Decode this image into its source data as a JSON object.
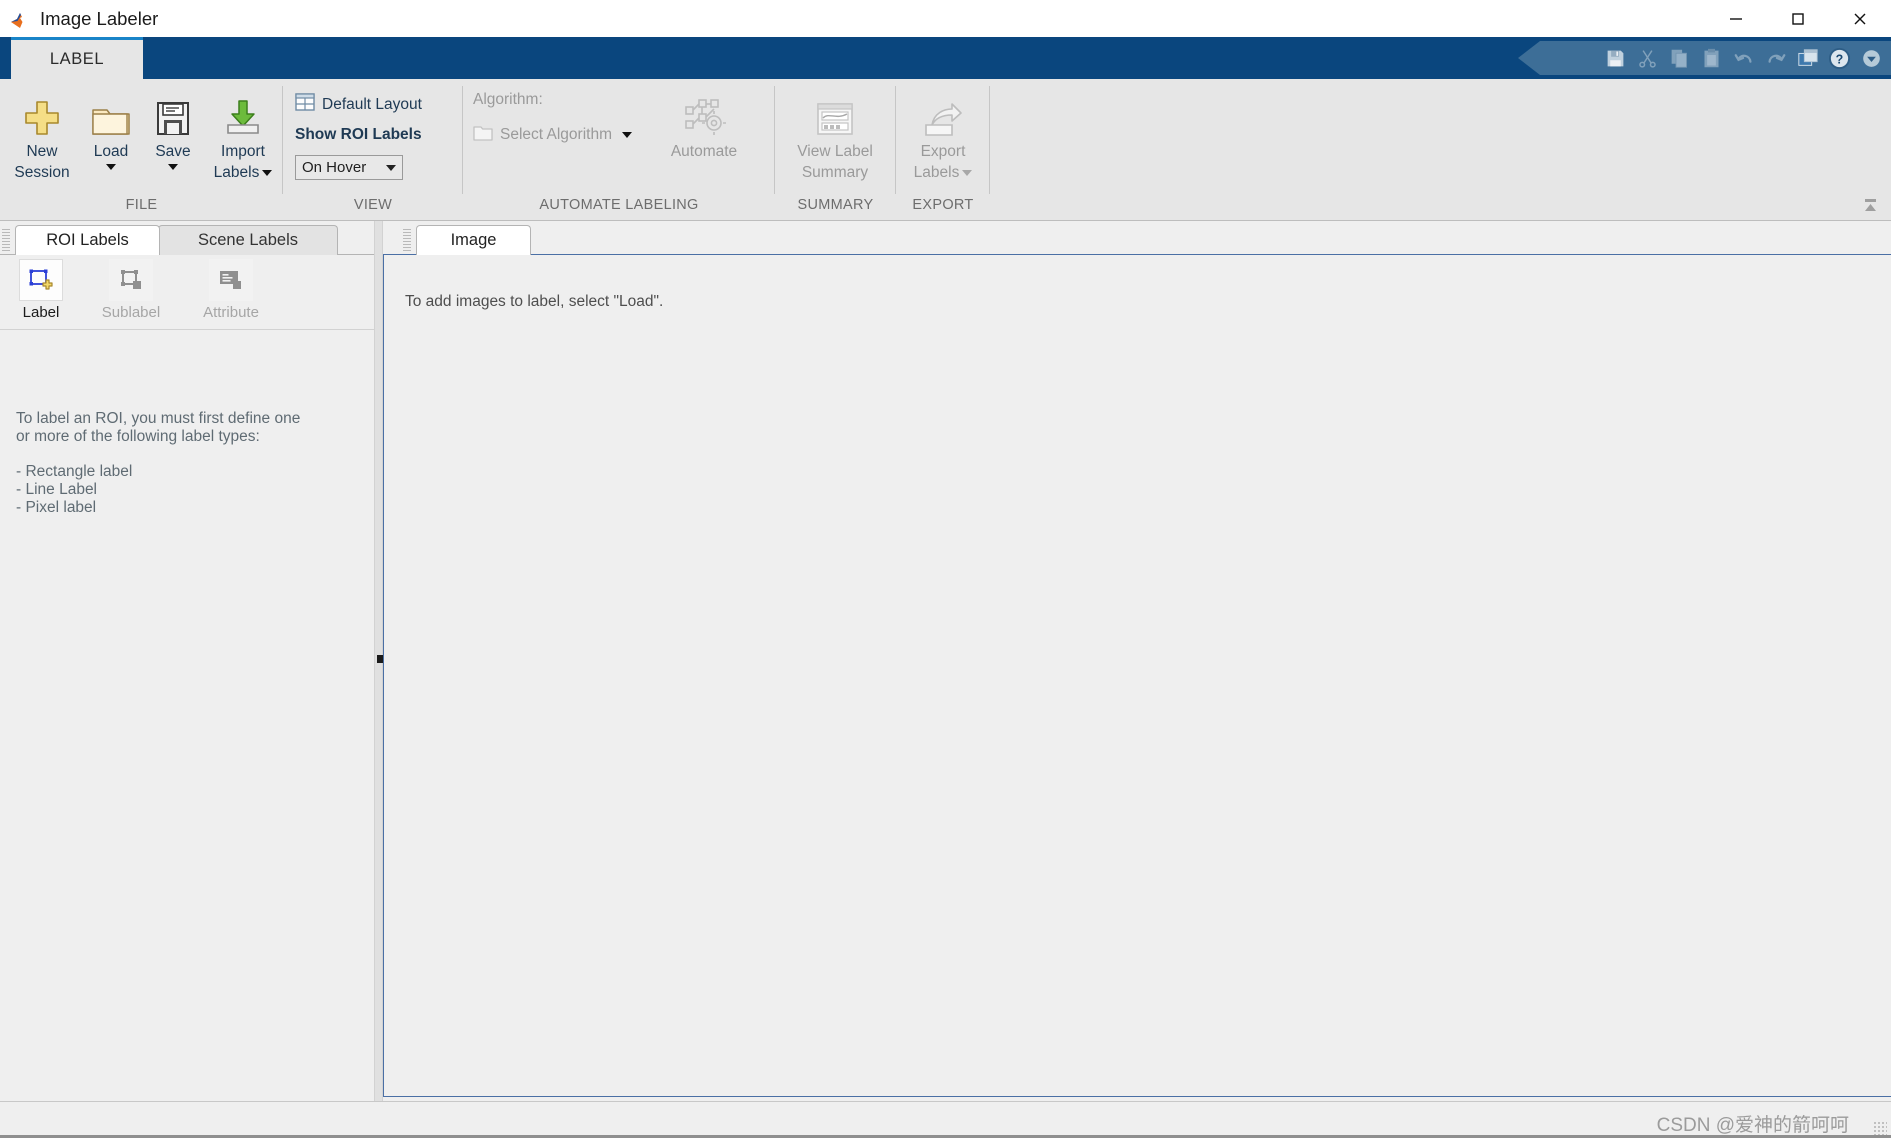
{
  "window": {
    "title": "Image Labeler",
    "logo_icon": "matlab-logo-icon",
    "controls": [
      {
        "name": "minimize-button",
        "glyph": "minimize-icon"
      },
      {
        "name": "maximize-button",
        "glyph": "maximize-icon"
      },
      {
        "name": "close-button",
        "glyph": "close-icon"
      }
    ]
  },
  "ribbon": {
    "tabs": [
      {
        "label": "LABEL",
        "active": true
      }
    ],
    "quick_access": [
      {
        "name": "save-icon",
        "enabled": true
      },
      {
        "name": "cut-icon",
        "enabled": false
      },
      {
        "name": "copy-icon",
        "enabled": false
      },
      {
        "name": "paste-icon",
        "enabled": false
      },
      {
        "name": "undo-icon",
        "enabled": false
      },
      {
        "name": "redo-icon",
        "enabled": false
      },
      {
        "name": "layout-icon",
        "enabled": true
      },
      {
        "name": "help-icon",
        "enabled": true
      },
      {
        "name": "quick-access-dropdown-icon",
        "enabled": true
      }
    ],
    "collapse_ribbon_icon": "collapse-ribbon-icon",
    "groups": [
      {
        "title": "FILE",
        "buttons": [
          {
            "label_line1": "New",
            "label_line2": "Session",
            "icon": "new-session-icon",
            "has_caret": false,
            "enabled": true
          },
          {
            "label_line1": "Load",
            "label_line2": "",
            "icon": "load-folder-icon",
            "has_caret": true,
            "enabled": true
          },
          {
            "label_line1": "Save",
            "label_line2": "",
            "icon": "save-floppy-icon",
            "has_caret": true,
            "enabled": true
          },
          {
            "label_line1": "Import",
            "label_line2": "Labels",
            "icon": "import-labels-icon",
            "has_caret": true,
            "enabled": true
          }
        ]
      },
      {
        "title": "VIEW",
        "layout_button": {
          "label": "Default Layout",
          "icon": "default-layout-icon"
        },
        "show_roi_labels_label": "Show ROI Labels",
        "show_roi_labels_value": "On Hover"
      },
      {
        "title": "AUTOMATE LABELING",
        "algorithm_label": "Algorithm:",
        "select_algorithm_label": "Select Algorithm",
        "select_algorithm_icon": "algorithm-folder-icon",
        "automate": {
          "label": "Automate",
          "icon": "automate-icon",
          "enabled": false
        }
      },
      {
        "title": "SUMMARY",
        "view_summary": {
          "label_line1": "View Label",
          "label_line2": "Summary",
          "icon": "view-label-summary-icon",
          "enabled": false
        }
      },
      {
        "title": "EXPORT",
        "export_labels": {
          "label_line1": "Export",
          "label_line2": "Labels",
          "icon": "export-labels-icon",
          "has_caret": true,
          "enabled": false
        }
      }
    ]
  },
  "left_panel": {
    "tabs": [
      {
        "label": "ROI Labels",
        "active": true
      },
      {
        "label": "Scene Labels",
        "active": false
      }
    ],
    "tools": [
      {
        "label": "Label",
        "icon": "add-label-icon",
        "enabled": true
      },
      {
        "label": "Sublabel",
        "icon": "add-sublabel-icon",
        "enabled": false
      },
      {
        "label": "Attribute",
        "icon": "add-attribute-icon",
        "enabled": false
      }
    ],
    "help_line1": "To label an ROI, you must first define one",
    "help_line2": "or more of the following label types:",
    "help_items": [
      "- Rectangle label",
      "- Line Label",
      "- Pixel label"
    ]
  },
  "right_panel": {
    "tabs": [
      {
        "label": "Image",
        "active": true
      }
    ],
    "empty_message": "To add images to label, select \"Load\"."
  },
  "status_bar": {
    "watermark": "CSDN @爱神的箭呵呵",
    "resize_grip_icon": "resize-grip-icon"
  },
  "colors": {
    "ribbon_tabstrip": "#0a467e",
    "tab_accent": "#1984c8",
    "ribbon_bg": "#e6e6e6",
    "panel_bg": "#efefef",
    "caption_text": "#1f3a54",
    "disabled_text": "#9a9a9a",
    "doc_border": "#4a6fa5"
  }
}
